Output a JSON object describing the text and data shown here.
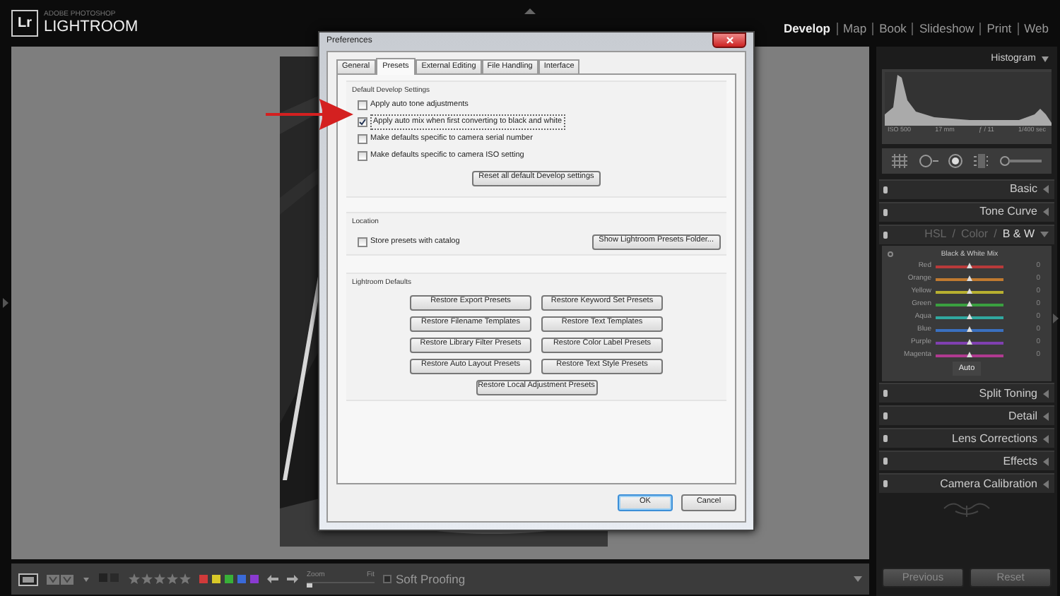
{
  "app": {
    "logo_mark": "Lr",
    "brand_small": "ADOBE PHOTOSHOP",
    "brand": "LIGHTROOM"
  },
  "modules": [
    {
      "label": "Develop",
      "selected": true
    },
    {
      "label": "Map",
      "selected": false
    },
    {
      "label": "Book",
      "selected": false
    },
    {
      "label": "Slideshow",
      "selected": false
    },
    {
      "label": "Print",
      "selected": false
    },
    {
      "label": "Web",
      "selected": false
    }
  ],
  "dialog": {
    "title": "Preferences",
    "tabs": [
      {
        "label": "General",
        "selected": false
      },
      {
        "label": "Presets",
        "selected": true
      },
      {
        "label": "External Editing",
        "selected": false
      },
      {
        "label": "File Handling",
        "selected": false
      },
      {
        "label": "Interface",
        "selected": false
      }
    ],
    "develop_defaults": {
      "title": "Default Develop Settings",
      "checkboxes": [
        {
          "label": "Apply auto tone adjustments",
          "checked": false
        },
        {
          "label": "Apply auto mix when first converting to black and white",
          "checked": true
        },
        {
          "label": "Make defaults specific to camera serial number",
          "checked": false
        },
        {
          "label": "Make defaults specific to camera ISO setting",
          "checked": false
        }
      ],
      "button": "Reset all default Develop settings"
    },
    "location": {
      "title": "Location",
      "checkbox": {
        "label": "Store presets with catalog",
        "checked": false
      },
      "button": "Show Lightroom Presets Folder..."
    },
    "lightroom_defaults": {
      "title": "Lightroom Defaults",
      "buttons": [
        "Restore Export Presets",
        "Restore Keyword Set Presets",
        "Restore Filename Templates",
        "Restore Text Templates",
        "Restore Library Filter Presets",
        "Restore Color Label Presets",
        "Restore Auto Layout Presets",
        "Restore Text Style Presets",
        "Restore Local Adjustment Presets"
      ]
    },
    "buttons": [
      {
        "label": "OK",
        "default": true
      },
      {
        "label": "Cancel",
        "default": false
      }
    ]
  },
  "histogram": {
    "title": "Histogram",
    "readouts": [
      "ISO 500",
      "17 mm",
      "ƒ / 11",
      "1/400 sec"
    ]
  },
  "panels": [
    {
      "kind": "simple",
      "label": "Basic",
      "expanded": false
    },
    {
      "kind": "simple",
      "label": "Tone Curve",
      "expanded": false
    },
    {
      "kind": "hsl",
      "expanded": true,
      "parts": [
        {
          "kind": "mode",
          "label": "HSL",
          "selected": false
        },
        {
          "kind": "sep",
          "label": "/"
        },
        {
          "kind": "mode",
          "label": "Color",
          "selected": false
        },
        {
          "kind": "sep",
          "label": "/"
        },
        {
          "kind": "mode",
          "label": "B & W",
          "selected": true
        }
      ],
      "mix": {
        "title": "Black & White Mix",
        "auto": "Auto",
        "channels": [
          {
            "name": "Red",
            "color": "#b83a3a",
            "level": 0.5,
            "reading": "0"
          },
          {
            "name": "Orange",
            "color": "#c07a30",
            "level": 0.5,
            "reading": "0"
          },
          {
            "name": "Yellow",
            "color": "#b8b030",
            "level": 0.5,
            "reading": "0"
          },
          {
            "name": "Green",
            "color": "#3aa040",
            "level": 0.5,
            "reading": "0"
          },
          {
            "name": "Aqua",
            "color": "#30a8a0",
            "level": 0.5,
            "reading": "0"
          },
          {
            "name": "Blue",
            "color": "#3a70c0",
            "level": 0.5,
            "reading": "0"
          },
          {
            "name": "Purple",
            "color": "#8040b0",
            "level": 0.5,
            "reading": "0"
          },
          {
            "name": "Magenta",
            "color": "#b03a90",
            "level": 0.5,
            "reading": "0"
          }
        ]
      }
    },
    {
      "kind": "simple",
      "label": "Split Toning",
      "expanded": false
    },
    {
      "kind": "simple",
      "label": "Detail",
      "expanded": false
    },
    {
      "kind": "simple",
      "label": "Lens Corrections",
      "expanded": false
    },
    {
      "kind": "simple",
      "label": "Effects",
      "expanded": false
    },
    {
      "kind": "simple",
      "label": "Camera Calibration",
      "expanded": false
    }
  ],
  "panel_buttons": [
    "Previous",
    "Reset"
  ],
  "toolbar": {
    "stars": 0,
    "color_labels": [
      {
        "color": "#d03a3a"
      },
      {
        "color": "#d8c828"
      },
      {
        "color": "#38b038"
      },
      {
        "color": "#3a6ad8"
      },
      {
        "color": "#8a3ad0"
      }
    ],
    "zoom": {
      "label": "Zoom",
      "fit": "Fit",
      "level": 0.0
    },
    "soft_proofing": {
      "label": "Soft Proofing",
      "checked": false
    }
  }
}
